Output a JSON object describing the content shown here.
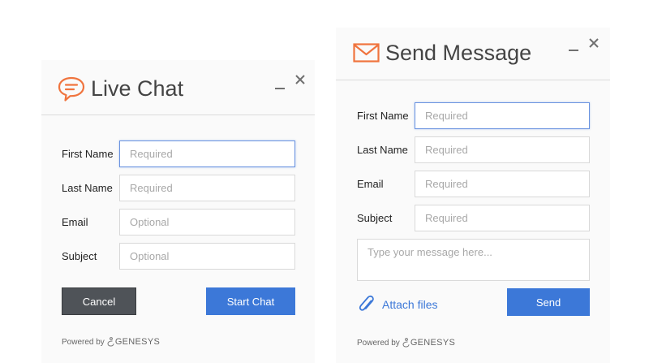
{
  "live_chat": {
    "title": "Live Chat",
    "fields": [
      {
        "label": "First Name",
        "placeholder": "Required"
      },
      {
        "label": "Last Name",
        "placeholder": "Required"
      },
      {
        "label": "Email",
        "placeholder": "Optional"
      },
      {
        "label": "Subject",
        "placeholder": "Optional"
      }
    ],
    "cancel_label": "Cancel",
    "start_label": "Start Chat",
    "powered_by": "Powered by",
    "brand": "GENESYS"
  },
  "send_message": {
    "title": "Send Message",
    "fields": [
      {
        "label": "First Name",
        "placeholder": "Required"
      },
      {
        "label": "Last Name",
        "placeholder": "Required"
      },
      {
        "label": "Email",
        "placeholder": "Required"
      },
      {
        "label": "Subject",
        "placeholder": "Required"
      }
    ],
    "message_placeholder": "Type your message here...",
    "attach_label": "Attach files",
    "send_label": "Send",
    "powered_by": "Powered by",
    "brand": "GENESYS"
  },
  "icons": {
    "chat": "chat-bubble-icon",
    "mail": "envelope-icon",
    "minimize": "minimize-icon",
    "close": "close-icon",
    "attach": "paperclip-icon",
    "brand": "genesys-logo-icon"
  },
  "colors": {
    "accent_orange": "#f0743e",
    "button_blue": "#3c78d8",
    "button_dark": "#4f5358",
    "focus_border": "#6b94e0"
  }
}
